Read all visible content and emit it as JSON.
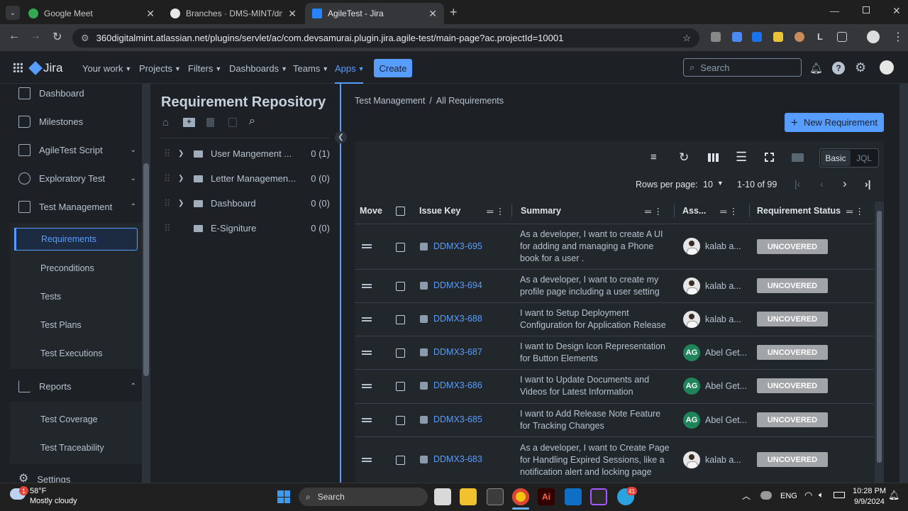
{
  "browser": {
    "tabs": [
      {
        "title": "Google Meet",
        "active": false
      },
      {
        "title": "Branches · DMS-MINT/dms-lett",
        "active": false
      },
      {
        "title": "AgileTest - Jira",
        "active": true
      }
    ],
    "url": "360digitalmint.atlassian.net/plugins/servlet/ac/com.devsamurai.plugin.jira.agile-test/main-page?ac.projectId=10001"
  },
  "jira": {
    "logo": "Jira",
    "menus": [
      "Your work",
      "Projects",
      "Filters",
      "Dashboards",
      "Teams",
      "Apps"
    ],
    "create_label": "Create",
    "search_placeholder": "Search"
  },
  "sidebar": {
    "items": [
      {
        "label": "Dashboard",
        "icon": "dashboard-icon"
      },
      {
        "label": "Milestones",
        "icon": "flag-icon"
      },
      {
        "label": "AgileTest Script",
        "icon": "script-icon"
      },
      {
        "label": "Exploratory Test",
        "icon": "refresh-icon"
      },
      {
        "label": "Test Management",
        "icon": "list-icon"
      }
    ],
    "test_management_sub": [
      "Requirements",
      "Preconditions",
      "Tests",
      "Test Plans",
      "Test Executions"
    ],
    "reports_label": "Reports",
    "reports_sub": [
      "Test Coverage",
      "Test Traceability"
    ],
    "settings_label": "Settings"
  },
  "repository": {
    "title": "Requirement Repository",
    "folders": [
      {
        "name": "User Mangement ...",
        "count": "0 (1)"
      },
      {
        "name": "Letter Managemen...",
        "count": "0 (0)"
      },
      {
        "name": "Dashboard",
        "count": "0 (0)"
      },
      {
        "name": "E-Signiture",
        "count": "0 (0)"
      }
    ]
  },
  "main": {
    "breadcrumb": [
      "Test Management",
      "All Requirements"
    ],
    "new_button": "New Requirement",
    "mode": {
      "basic": "Basic",
      "jql": "JQL",
      "selected": "Basic"
    },
    "rows_per_page_label": "Rows per page:",
    "rows_per_page": "10",
    "range": "1-10 of 99",
    "columns": [
      "Move",
      "Issue Key",
      "Summary",
      "Ass...",
      "Requirement Status"
    ],
    "rows": [
      {
        "key": "DDMX3-695",
        "summary": "As a developer, I want to create A UI for adding and managing a Phone book for a user .",
        "assignee": "kalab a...",
        "avatar": "photo",
        "status": "UNCOVERED"
      },
      {
        "key": "DDMX3-694",
        "summary": "As a developer, I want to create my profile page including a user setting",
        "assignee": "kalab a...",
        "avatar": "photo",
        "status": "UNCOVERED"
      },
      {
        "key": "DDMX3-688",
        "summary": "I want to Setup Deployment Configuration for Application Release",
        "assignee": "kalab a...",
        "avatar": "photo",
        "status": "UNCOVERED"
      },
      {
        "key": "DDMX3-687",
        "summary": "I want to Design Icon Representation for Button Elements",
        "assignee": "Abel Get...",
        "avatar": "AG",
        "status": "UNCOVERED"
      },
      {
        "key": "DDMX3-686",
        "summary": "I want to Update Documents and Videos for Latest Information",
        "assignee": "Abel Get...",
        "avatar": "AG",
        "status": "UNCOVERED"
      },
      {
        "key": "DDMX3-685",
        "summary": "I want to Add Release Note Feature for Tracking Changes",
        "assignee": "Abel Get...",
        "avatar": "AG",
        "status": "UNCOVERED"
      },
      {
        "key": "DDMX3-683",
        "summary": "As a developer, I want to Create Page for Handling Expired Sessions, like a notification alert and locking page",
        "assignee": "kalab a...",
        "avatar": "photo",
        "status": "UNCOVERED"
      }
    ]
  },
  "taskbar": {
    "weather_temp": "58°F",
    "weather_desc": "Mostly cloudy",
    "weather_badge": "1",
    "search": "Search",
    "lang": "ENG",
    "time": "10:28 PM",
    "date": "9/9/2024",
    "telegram_badge": "41"
  }
}
